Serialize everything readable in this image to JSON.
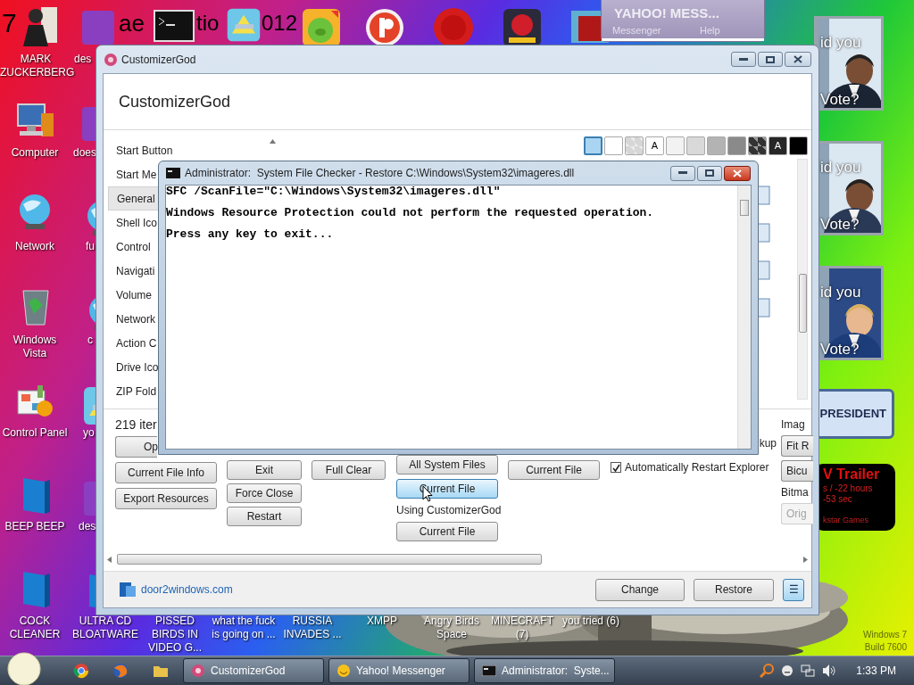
{
  "desktop": {
    "wallpaper_text": [
      "7",
      "ae",
      "tio",
      "012"
    ],
    "icons": [
      {
        "label": "MARK ZUCKERBERG"
      },
      {
        "label": "des"
      },
      {
        "label": "Computer"
      },
      {
        "label": "does"
      },
      {
        "label": "Network"
      },
      {
        "label": "fu"
      },
      {
        "label": "Windows Vista"
      },
      {
        "label": "c"
      },
      {
        "label": "Control Panel"
      },
      {
        "label": "yo"
      },
      {
        "label": "BEEP BEEP"
      },
      {
        "label": "des"
      },
      {
        "label": "COCK CLEANER"
      },
      {
        "label": "ULTRA CD BLOATWARE"
      },
      {
        "label": "PISSED BIRDS IN VIDEO G..."
      },
      {
        "label": "what the fuck is going on ..."
      },
      {
        "label": "RUSSIA INVADES ..."
      },
      {
        "label": "XMPP"
      },
      {
        "label": "Angry Birds Space"
      },
      {
        "label": "MINECRAFT (7)"
      },
      {
        "label": "you tried (6)"
      }
    ],
    "watermark": [
      "Windows 7",
      "Build 7600"
    ]
  },
  "gadgets": {
    "polls": [
      {
        "top": "id you",
        "bottom": "Vote?"
      },
      {
        "top": "id you",
        "bottom": "Vote?"
      },
      {
        "top": "id you",
        "bottom": "Vote?"
      }
    ],
    "badge": "PRESIDENT",
    "trailer": {
      "title": "V  Trailer",
      "lines": [
        "s / -22 hours",
        "-53 sec"
      ],
      "footer": "kstar Games"
    }
  },
  "yahoo_window": {
    "title": "YAHOO! MESS...",
    "menu": [
      "Messenger",
      "Help"
    ]
  },
  "customizer": {
    "title": "CustomizerGod",
    "heading": "CustomizerGod",
    "categories": [
      {
        "label": "Start Button",
        "selected": false
      },
      {
        "label": "Start Me",
        "selected": false
      },
      {
        "label": "General",
        "selected": true
      },
      {
        "label": "Shell Ico",
        "selected": false
      },
      {
        "label": "Control",
        "selected": false
      },
      {
        "label": "Navigati",
        "selected": false
      },
      {
        "label": "Volume",
        "selected": false
      },
      {
        "label": "Network",
        "selected": false
      },
      {
        "label": "Action C",
        "selected": false
      },
      {
        "label": "Drive Ico",
        "selected": false
      },
      {
        "label": "ZIP Fold",
        "selected": false
      }
    ],
    "swatches": [
      {
        "kind": "solid",
        "color": "#a9d5f3",
        "selected": true
      },
      {
        "kind": "solid",
        "color": "#ffffff",
        "selected": false
      },
      {
        "kind": "checker",
        "color": "#d6d6d6",
        "selected": false
      },
      {
        "kind": "text",
        "label": "A",
        "color": "#ffffff",
        "selected": false
      },
      {
        "kind": "solid",
        "color": "#f2f2f2",
        "selected": false
      },
      {
        "kind": "solid",
        "color": "#d9d9d9",
        "selected": false
      },
      {
        "kind": "solid",
        "color": "#b3b3b3",
        "selected": false
      },
      {
        "kind": "solid",
        "color": "#8a8a8a",
        "selected": false
      },
      {
        "kind": "checker",
        "color": "#333333",
        "selected": false
      },
      {
        "kind": "text",
        "label": "A",
        "color": "#262626",
        "selected": false
      },
      {
        "kind": "solid",
        "color": "#000000",
        "selected": false
      }
    ],
    "panel_columns": [
      [
        {
          "kind": "text",
          "label": "219 iter"
        },
        {
          "kind": "button",
          "label": "Op",
          "hovered": false,
          "disabled": false
        },
        {
          "kind": "button",
          "label": "Current File Info",
          "hovered": false,
          "disabled": false
        },
        {
          "kind": "button",
          "label": "Export Resources",
          "hovered": false,
          "disabled": false
        }
      ],
      [
        {
          "kind": "button",
          "label": "Exit",
          "hovered": false,
          "disabled": false
        },
        {
          "kind": "button",
          "label": "Force Close",
          "hovered": false,
          "disabled": false
        },
        {
          "kind": "button",
          "label": "Restart",
          "hovered": false,
          "disabled": false
        }
      ],
      [
        {
          "kind": "button",
          "label": "Full Clear",
          "hovered": false,
          "disabled": false
        }
      ],
      [
        {
          "kind": "button",
          "label": "All System Files",
          "hovered": false,
          "disabled": false
        },
        {
          "kind": "button",
          "label": "Current File",
          "hovered": true,
          "disabled": false
        },
        {
          "kind": "text",
          "label": "Using CustomizerGod"
        },
        {
          "kind": "button",
          "label": "Current File",
          "hovered": false,
          "disabled": false
        }
      ],
      [
        {
          "kind": "button",
          "label": "Current File",
          "hovered": false,
          "disabled": false
        }
      ],
      [
        {
          "kind": "text",
          "label": "kup"
        },
        {
          "kind": "checkbox",
          "label": "Automatically Restart Explorer",
          "checked": true
        }
      ],
      [
        {
          "kind": "text",
          "label": "Imag"
        },
        {
          "kind": "button",
          "label": "Fit R",
          "hovered": false,
          "disabled": false
        },
        {
          "kind": "button",
          "label": "Bicu",
          "hovered": false,
          "disabled": false
        },
        {
          "kind": "text",
          "label": "Bitma"
        },
        {
          "kind": "button",
          "label": "Orig",
          "hovered": false,
          "disabled": true
        }
      ]
    ],
    "footer": {
      "link": "door2windows.com",
      "buttons": [
        {
          "label": "Change",
          "selected": false
        },
        {
          "label": "Restore",
          "selected": false
        },
        {
          "label": "☰",
          "selected": true
        }
      ]
    }
  },
  "cmd_window": {
    "title": "Administrator:  System File Checker - Restore C:\\Windows\\System32\\imageres.dll",
    "lines": [
      "SFC /ScanFile=\"C:\\Windows\\System32\\imageres.dll\"",
      "Windows Resource Protection could not perform the requested operation.",
      "Press any key to exit..."
    ]
  },
  "taskbar": {
    "tasks": [
      {
        "label": "CustomizerGod"
      },
      {
        "label": "Yahoo! Messenger"
      },
      {
        "label": "Administrator:  Syste..."
      }
    ],
    "clock": "1:33 PM"
  }
}
